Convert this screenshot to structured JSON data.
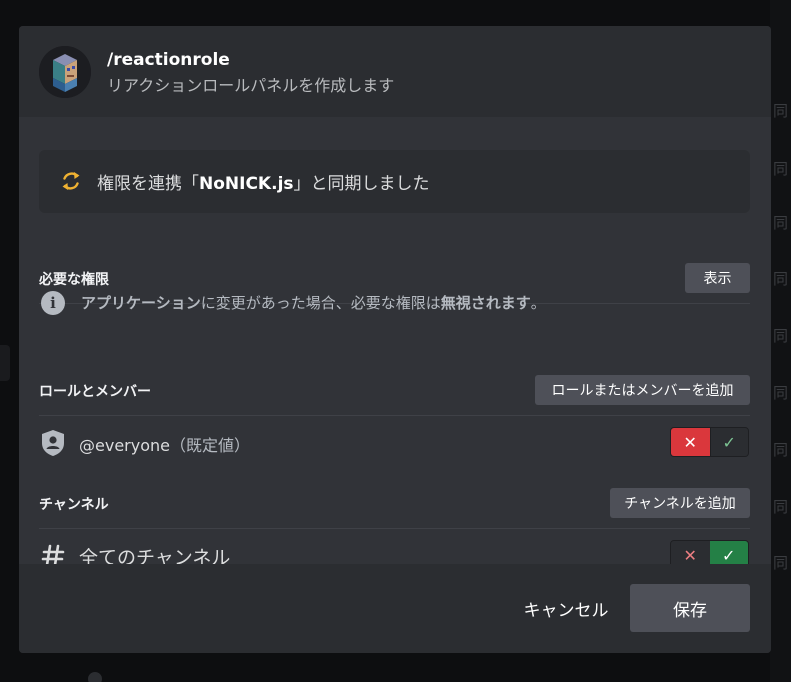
{
  "command": {
    "name": "/reactionrole",
    "description": "リアクションロールパネルを作成します"
  },
  "sync": {
    "prefix": "権限を連携「",
    "bot_name": "NoNICK.js",
    "suffix": "」と同期しました",
    "icon": "sync-icon",
    "icon_color": "#f0b232"
  },
  "required_permissions": {
    "title": "必要な権限",
    "show_button": "表示"
  },
  "info": {
    "icon": "info-icon",
    "app_label": "アプリケーション",
    "text_mid": "に変更があった場合、必要な権限は",
    "ignored_label": "無視されます",
    "text_end": "。"
  },
  "roles_members": {
    "title": "ロールとメンバー",
    "add_button": "ロールまたはメンバーを追加",
    "entry": {
      "icon": "shield-role-icon",
      "name": "@everyone",
      "suffix": "（既定値）",
      "deny_symbol": "✕",
      "allow_symbol": "✓",
      "state": "deny"
    }
  },
  "channels": {
    "title": "チャンネル",
    "add_button": "チャンネルを追加",
    "entry": {
      "icon": "hash-icon",
      "name": "全てのチャンネル",
      "deny_symbol": "✕",
      "allow_symbol": "✓",
      "state": "allow"
    }
  },
  "footer": {
    "cancel_label": "キャンセル",
    "save_label": "保存"
  },
  "background": {
    "right_glyph": "同"
  },
  "colors": {
    "modal_bg": "#313338",
    "header_bg": "#2b2d31",
    "deny_red": "#da373c",
    "allow_green": "#248046",
    "button_gray": "#4e5058"
  }
}
